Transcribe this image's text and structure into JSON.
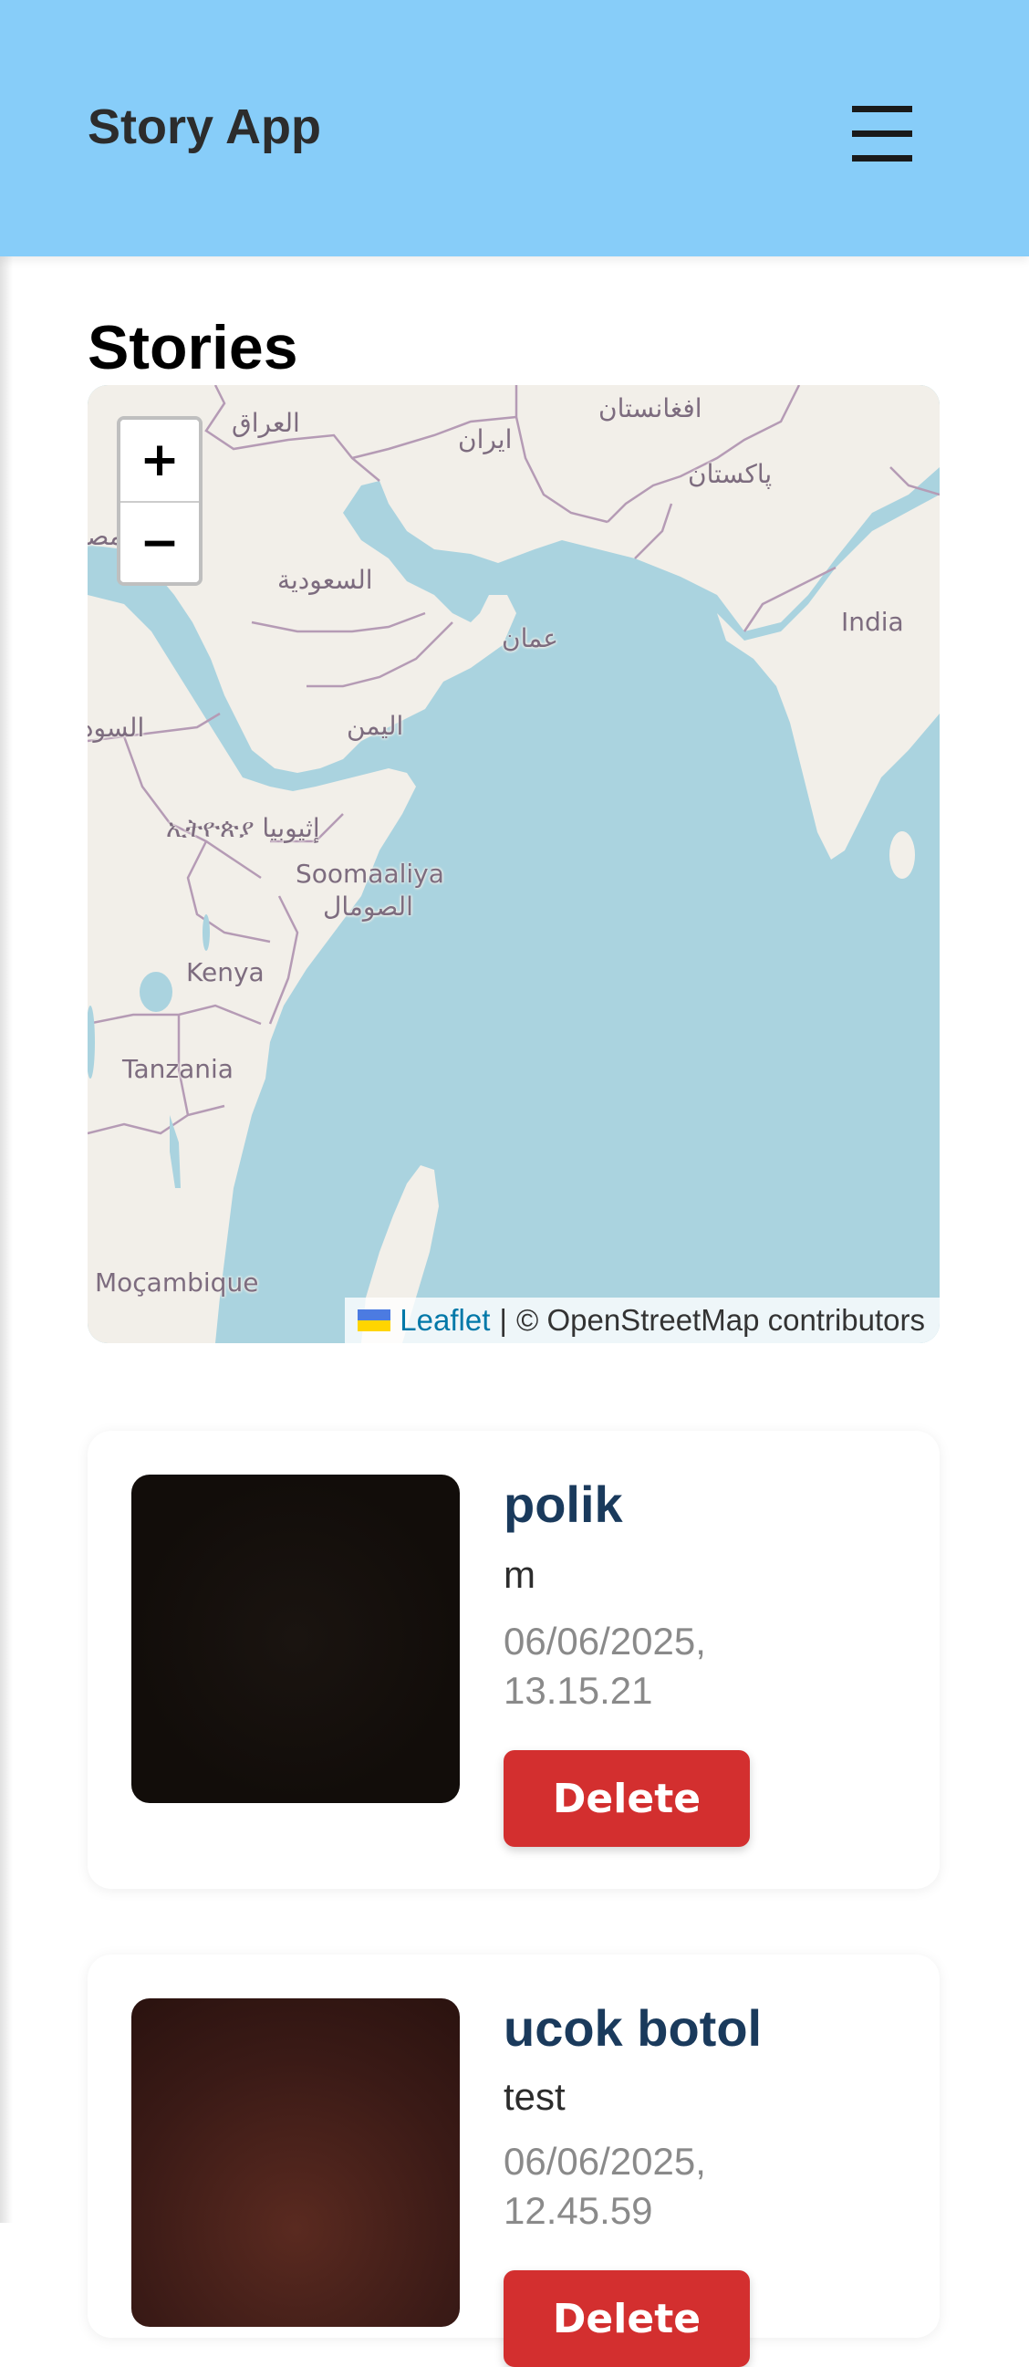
{
  "header": {
    "app_title": "Story App",
    "menu_icon": "hamburger-menu-icon"
  },
  "main": {
    "heading": "Stories"
  },
  "map": {
    "zoom_in_label": "+",
    "zoom_out_label": "−",
    "attribution": {
      "flag_icon": "ukraine-flag-icon",
      "leaflet_link": "Leaflet",
      "separator": "|",
      "osm_text": "© OpenStreetMap contributors"
    },
    "labels": {
      "iraq": "العراق",
      "iran": "ايران",
      "afghanistan": "افغانستان",
      "pakistan": "پاکستان",
      "egypt_partial": "مصر",
      "saudi": "السعودية",
      "oman": "عمان",
      "india": "India",
      "sudan": "السود",
      "yemen": "اليمن",
      "ethiopia": "ኢትዮጵያ إثيوبيا",
      "somalia_latin": "Soomaaliya",
      "somalia_arabic": "الصومال",
      "kenya": "Kenya",
      "tanzania": "Tanzania",
      "mozambique": "Moçambique"
    },
    "colors": {
      "water": "#aad3df",
      "land": "#f2efe9",
      "border": "#b59bb5",
      "label": "#7d6c7f"
    }
  },
  "stories": [
    {
      "title": "polik",
      "description": "m",
      "date": "06/06/2025, 13.15.21",
      "delete_label": "Delete",
      "image_color": "#120d0a"
    },
    {
      "title": "ucok botol",
      "description": "test",
      "date": "06/06/2025, 12.45.59",
      "delete_label": "Delete",
      "image_color": "#3a1a16"
    }
  ],
  "colors": {
    "header_bg": "#87cdf9",
    "title_blue": "#1a3a5c",
    "delete_red": "#d32f2f",
    "date_gray": "#8a8a8a"
  }
}
